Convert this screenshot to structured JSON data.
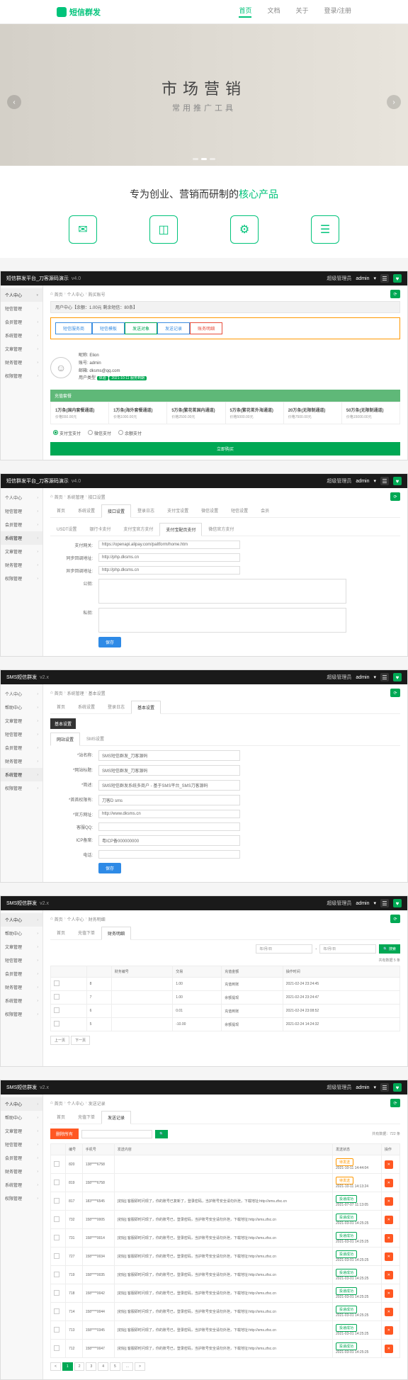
{
  "landing": {
    "logo": "短信群发",
    "nav": [
      "首页",
      "文档",
      "关于",
      "登录/注册"
    ],
    "hero_title": "市场营销",
    "hero_sub": "常用推广工具",
    "tagline_pre": "专为创业、营销而研制的",
    "tagline_hl": "核心产品"
  },
  "common": {
    "title1": "短信群发平台_刀客源码演示",
    "title2": "SMS短信群发",
    "version": "v4.0",
    "version2": "v2.x",
    "role": "超级管理员",
    "user": "admin",
    "sidebar": [
      "个人中心",
      "短信管理",
      "会员管理",
      "系统管理",
      "文章管理",
      "财务管理",
      "权限管理"
    ],
    "sidebar2": [
      "个人中心",
      "帮助中心",
      "文章管理",
      "短信管理",
      "会员管理",
      "财务管理",
      "系统管理",
      "权限管理"
    ],
    "home_icon": "⌂",
    "bc_home": "首页",
    "bc_personal": "个人中心"
  },
  "panel1": {
    "bc_last": "购买账号",
    "balance_label": "用户中心【余额：1.00元 剩余短信：80条】",
    "ctabs": [
      "短信服务商",
      "短信模板",
      "发送对象",
      "发送记录",
      "账务明细"
    ],
    "info": {
      "nick": "昵称: Elion",
      "name": "账号: admin",
      "email": "邮箱: dksms@qq.com",
      "type_label": "用户类型",
      "type_val": "体验",
      "expire": "2021-10-11 服务到期"
    },
    "pkg_header": "充值套餐",
    "packages": [
      {
        "name": "1万条(国内套餐通道)",
        "price": "价格550.00元"
      },
      {
        "name": "1万条(海外套餐通道)",
        "price": "价格1000.00元"
      },
      {
        "name": "5万条(繁花茗国内通道)",
        "price": "价格2500.00元"
      },
      {
        "name": "5万条(繁花茗外海通道)",
        "price": "价格5000.00元"
      },
      {
        "name": "20万条(无限制通道)",
        "price": "价格7500.00元"
      },
      {
        "name": "50万条(无限制通道)",
        "price": "价格15000.00元"
      }
    ],
    "pay_opts": [
      "支付宝支付",
      "微信支付",
      "余额支付"
    ],
    "submit": "立即购买"
  },
  "panel2": {
    "bc": [
      "系统管理",
      "接口设置"
    ],
    "tabs": [
      "USDT设置",
      "银行卡支付",
      "支付宝官方支付",
      "支付宝配页支付",
      "微信官方支付"
    ],
    "outer_tabs": [
      "首页",
      "系统设置",
      "接口设置",
      "登录日志",
      "支付宝设置",
      "微信设置",
      "短信设置",
      "会员"
    ],
    "fields": [
      {
        "label": "支付网关:",
        "value": "https://openapi.alipay.com/paltform/home.htm"
      },
      {
        "label": "同步回调地址:",
        "value": "http://php.dksms.cn"
      },
      {
        "label": "异步回调地址:",
        "value": "http://php.dksms.cn"
      },
      {
        "label": "公钥:",
        "value": ""
      },
      {
        "label": "私钥:",
        "value": ""
      }
    ],
    "save": "保存"
  },
  "panel3": {
    "bc": [
      "系统管理",
      "基本设置"
    ],
    "tabs": [
      "网站设置",
      "SMS设置"
    ],
    "outer_tabs": [
      "首页",
      "系统设置",
      "登录日志",
      "基本设置"
    ],
    "fields": [
      {
        "label": "*站名称:",
        "value": "SMS短信群发_刀客源码"
      },
      {
        "label": "*网站标题:",
        "value": "SMS短信群发_刀客源码"
      },
      {
        "label": "*简述:",
        "value": "SMS短信群发系统多商户 - 基于SMS平台_SMS刀客源码"
      },
      {
        "label": "*首首权限有:",
        "value": "刀客D sms"
      },
      {
        "label": "*官方网址:",
        "value": "http://www.dksms.cn"
      },
      {
        "label": "客服QQ:",
        "value": ""
      },
      {
        "label": "ICP备案:",
        "value": "粤ICP备000000000"
      },
      {
        "label": "电话:",
        "value": ""
      }
    ],
    "save": "保存"
  },
  "panel4": {
    "bc_last": "财务明细",
    "outer_tabs": [
      "首页",
      "充值下单",
      "财务明细"
    ],
    "date1": "年/月/日",
    "date2": "年/月/日",
    "search": "搜索",
    "total": "共有数据 5 条",
    "headers": [
      "",
      "",
      "财务编号",
      "交易",
      "充值金额",
      "操作时间"
    ],
    "rows": [
      {
        "id": "8",
        "amt": "1.00",
        "type": "充值到账",
        "time": "2021-02-24 23:24:45"
      },
      {
        "id": "7",
        "amt": "1.00",
        "type": "余额提现",
        "time": "2021-02-24 23:24:47"
      },
      {
        "id": "6",
        "amt": "0.01",
        "type": "充值到账",
        "time": "2021-02-24 23:08:52"
      },
      {
        "id": "5",
        "amt": "-10.00",
        "type": "余额提现",
        "time": "2021-02-24 14:24:32"
      }
    ],
    "pager": [
      "上一页",
      "下一页"
    ]
  },
  "panel5": {
    "bc_last": "发送记录",
    "outer_tabs": [
      "首页",
      "充值下单",
      "发送记录"
    ],
    "del_sel": "删除所有",
    "search_ph": "手机号",
    "total": "共有数据：722 条",
    "headers": [
      "",
      "编号",
      "手机号",
      "发送内容",
      "发送状态",
      "操作"
    ],
    "rows": [
      {
        "id": "820",
        "phone": "138****6758",
        "content": "",
        "status": "待发送",
        "status_cls": "orange",
        "time": "2021-10-11 14:44:04"
      },
      {
        "id": "819",
        "phone": "158****6758",
        "content": "",
        "status": "待发送",
        "status_cls": "orange",
        "time": "2021-10-11 14:13:24"
      },
      {
        "id": "817",
        "phone": "183****6545",
        "content": "[初始] 客服即时问现了，你的账号已复新了，登录密码，当护账号安全请勿外泄，下载地址:http://sms.zfsc.cn",
        "status": "投递成功",
        "status_cls": "green",
        "time": "2021-07-07 11:13:05"
      },
      {
        "id": "732",
        "phone": "158****0005",
        "content": "[初始] 客服即时问现了，你的账号已，登录密码，当护账号安全请勿外泄，下载地址:http://sms.zfsc.cn",
        "status": "投递成功",
        "status_cls": "green",
        "time": "2021-03-01 14:25:25"
      },
      {
        "id": "731",
        "phone": "158****0014",
        "content": "[初始] 客服即时问现了，你的账号已，登录密码，当护账号安全请勿外泄，下载地址:http://sms.zfsc.cn",
        "status": "投递成功",
        "status_cls": "green",
        "time": "2021-03-01 14:25:25"
      },
      {
        "id": "727",
        "phone": "158****0034",
        "content": "[初始] 客服即时问现了，你的账号已，登录密码，当护账号安全请勿外泄，下载地址:http://sms.zfsc.cn",
        "status": "投递成功",
        "status_cls": "green",
        "time": "2021-03-01 14:25:25"
      },
      {
        "id": "719",
        "phone": "158****0035",
        "content": "[初始] 客服即时问现了，你的账号已，登录密码，当护账号安全请勿外泄，下载地址:http://sms.zfsc.cn",
        "status": "投递成功",
        "status_cls": "green",
        "time": "2021-03-01 14:25:25"
      },
      {
        "id": "718",
        "phone": "158****0042",
        "content": "[初始] 客服即时问现了，你的账号已，登录密码，当护账号安全请勿外泄，下载地址:http://sms.zfsc.cn",
        "status": "投递成功",
        "status_cls": "green",
        "time": "2021-03-01 14:25:25"
      },
      {
        "id": "714",
        "phone": "158****0044",
        "content": "[初始] 客服即时问现了，你的账号已，登录密码，当护账号安全请勿外泄，下载地址:http://sms.zfsc.cn",
        "status": "投递成功",
        "status_cls": "green",
        "time": "2021-03-01 14:25:25"
      },
      {
        "id": "713",
        "phone": "158****0345",
        "content": "[初始] 客服即时问现了，你的账号已，登录密码，当护账号安全请勿外泄，下载地址:http://sms.zfsc.cn",
        "status": "投递成功",
        "status_cls": "green",
        "time": "2021-03-01 14:25:25"
      },
      {
        "id": "712",
        "phone": "158****0047",
        "content": "[初始] 客服即时问现了，你的账号已，登录密码，当护账号安全请勿外泄，下载地址:http://sms.zfsc.cn",
        "status": "投递成功",
        "status_cls": "green",
        "time": "2021-03-01 14:25:25"
      }
    ],
    "pager": [
      "<",
      "1",
      "2",
      "3",
      "4",
      "5",
      "...",
      ">"
    ]
  }
}
